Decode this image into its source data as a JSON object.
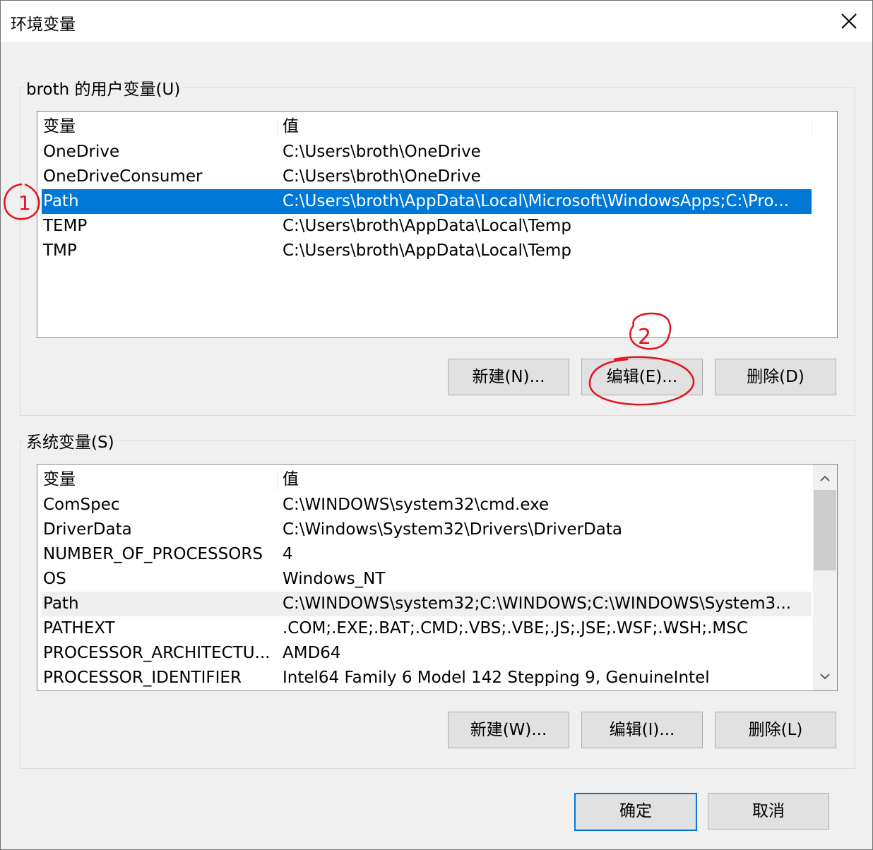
{
  "window": {
    "title": "环境变量"
  },
  "user_vars": {
    "group_label": "broth 的用户变量(U)",
    "header": {
      "name": "变量",
      "value": "值"
    },
    "rows": [
      {
        "name": "OneDrive",
        "value": "C:\\Users\\broth\\OneDrive"
      },
      {
        "name": "OneDriveConsumer",
        "value": "C:\\Users\\broth\\OneDrive"
      },
      {
        "name": "Path",
        "value": "C:\\Users\\broth\\AppData\\Local\\Microsoft\\WindowsApps;C:\\Pro..."
      },
      {
        "name": "TEMP",
        "value": "C:\\Users\\broth\\AppData\\Local\\Temp"
      },
      {
        "name": "TMP",
        "value": "C:\\Users\\broth\\AppData\\Local\\Temp"
      }
    ],
    "selected_row": "Path",
    "buttons": {
      "new": "新建(N)...",
      "edit": "编辑(E)...",
      "delete": "删除(D)"
    }
  },
  "system_vars": {
    "group_label": "系统变量(S)",
    "header": {
      "name": "变量",
      "value": "值"
    },
    "rows": [
      {
        "name": "ComSpec",
        "value": "C:\\WINDOWS\\system32\\cmd.exe"
      },
      {
        "name": "DriverData",
        "value": "C:\\Windows\\System32\\Drivers\\DriverData"
      },
      {
        "name": "NUMBER_OF_PROCESSORS",
        "value": "4"
      },
      {
        "name": "OS",
        "value": "Windows_NT"
      },
      {
        "name": "Path",
        "value": "C:\\WINDOWS\\system32;C:\\WINDOWS;C:\\WINDOWS\\System3..."
      },
      {
        "name": "PATHEXT",
        "value": ".COM;.EXE;.BAT;.CMD;.VBS;.VBE;.JS;.JSE;.WSF;.WSH;.MSC"
      },
      {
        "name": "PROCESSOR_ARCHITECTU...",
        "value": "AMD64"
      },
      {
        "name": "PROCESSOR_IDENTIFIER",
        "value": "Intel64 Family 6 Model 142 Stepping 9, GenuineIntel"
      }
    ],
    "hovered_row": "Path",
    "buttons": {
      "new": "新建(W)...",
      "edit": "编辑(I)...",
      "delete": "删除(L)"
    }
  },
  "footer": {
    "ok": "确定",
    "cancel": "取消"
  },
  "annotations": {
    "marker_1": "1",
    "marker_2": "2",
    "color": "#e0141e"
  },
  "colors": {
    "selection": "#0078d7",
    "accent_border": "#0078d7"
  }
}
